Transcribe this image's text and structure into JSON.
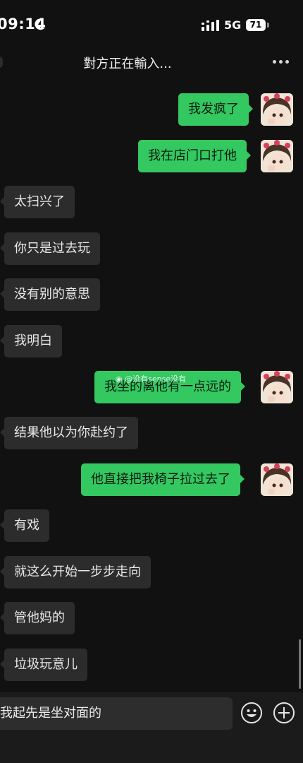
{
  "status_bar": {
    "time": "09:14",
    "network": "5G",
    "battery": "71"
  },
  "header": {
    "title": "對方正在輸入..."
  },
  "messages": [
    {
      "side": "right",
      "text": "我发疯了"
    },
    {
      "side": "right",
      "text": "我在店门口打他"
    },
    {
      "side": "left",
      "text": "太扫兴了"
    },
    {
      "side": "left",
      "text": "你只是过去玩"
    },
    {
      "side": "left",
      "text": "没有别的意思"
    },
    {
      "side": "left",
      "text": "我明白"
    },
    {
      "side": "right",
      "text": "我坐的离他有一点远的"
    },
    {
      "side": "left",
      "text": "结果他以为你赴约了"
    },
    {
      "side": "right",
      "text": "他直接把我椅子拉过去了"
    },
    {
      "side": "left",
      "text": "有戏"
    },
    {
      "side": "left",
      "text": "就这么开始一步步走向"
    },
    {
      "side": "left",
      "text": "管他妈的"
    },
    {
      "side": "left",
      "text": "垃圾玩意儿"
    }
  ],
  "watermark": "@没有sense没有",
  "composer": {
    "value": "我起先是坐对面的"
  },
  "icons": {
    "status": [
      "moon-icon",
      "signal-icon"
    ],
    "header": [
      "more-icon"
    ],
    "composer": [
      "emoji-icon",
      "plus-icon"
    ]
  },
  "colors": {
    "background": "#111111",
    "incoming_bubble": "#2c2c2c",
    "outgoing_bubble": "#33c860"
  }
}
